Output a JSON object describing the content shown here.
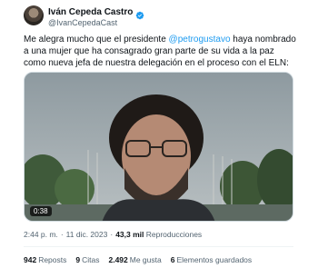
{
  "author": {
    "name": "Iván Cepeda Castro",
    "handle": "@IvanCepedaCast",
    "verified": true,
    "verified_color": "#1d9bf0"
  },
  "tweet": {
    "text_before": "Me alegra mucho que el presidente ",
    "mention": "@petrogustavo",
    "text_after": " haya nombrado a una mujer que ha consagrado gran parte de su vida a la paz como nueva jefa de nuestra delegación en el proceso con el ELN:",
    "mention_color": "#1d9bf0"
  },
  "media": {
    "type": "video",
    "duration": "0:38"
  },
  "meta": {
    "time": "2:44 p. m.",
    "date": "11 dic. 2023",
    "views_count": "43,3 mil",
    "views_label": "Reproducciones"
  },
  "stats": {
    "reposts_count": "942",
    "reposts_label": "Reposts",
    "quotes_count": "9",
    "quotes_label": "Citas",
    "likes_count": "2.492",
    "likes_label": "Me gusta",
    "bookmarks_count": "6",
    "bookmarks_label": "Elementos guardados"
  }
}
